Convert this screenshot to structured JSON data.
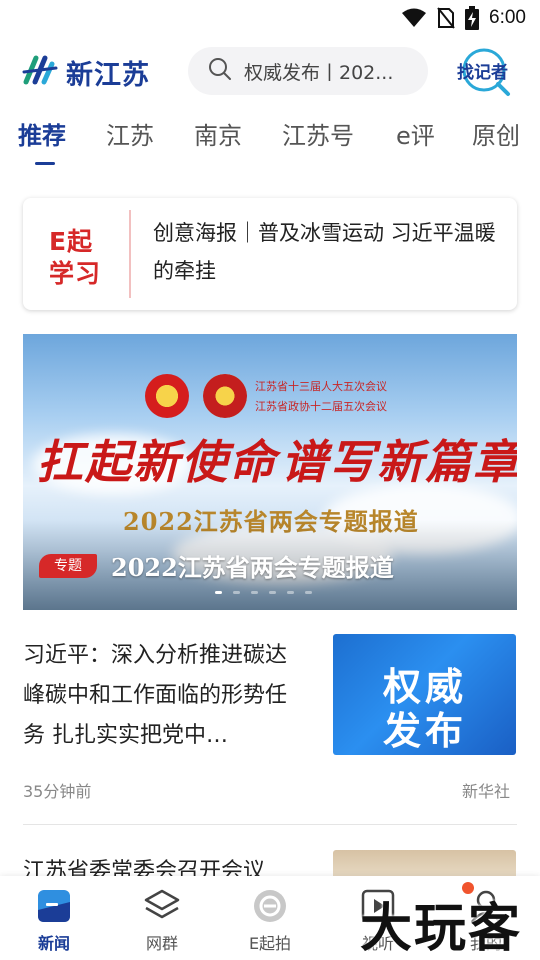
{
  "status_bar": {
    "time": "6:00",
    "icons": [
      "wifi-icon",
      "no-sim-icon",
      "battery-charging-icon"
    ]
  },
  "header": {
    "logo_text": "新江苏",
    "search_placeholder": "权威发布丨202...",
    "reporter_label": "找记者"
  },
  "tabs": [
    {
      "label": "推荐",
      "active": true
    },
    {
      "label": "江苏"
    },
    {
      "label": "南京"
    },
    {
      "label": "江苏号"
    },
    {
      "label": "e评"
    },
    {
      "label": "原创"
    }
  ],
  "study_card": {
    "logo_line1": "E起",
    "logo_line2": "学习",
    "text": "创意海报｜普及冰雪运动  习近平温暖的牵挂"
  },
  "banner": {
    "meeting1": "江苏省十三届人大五次会议",
    "meeting2": "江苏省政协十二届五次会议",
    "slogan1": "扛起新使命",
    "slogan2": "谱写新篇章",
    "subtitle": "2022江苏省两会专题报道",
    "badge": "专题",
    "title": "2022江苏省两会专题报道",
    "slide_count": 6,
    "active_slide": 0
  },
  "news": [
    {
      "title": "习近平：深入分析推进碳达峰碳中和工作面临的形势任务  扎扎实实把党中…",
      "thumb_line1": "权威",
      "thumb_line2": "发布",
      "time": "35分钟前",
      "source": "新华社"
    },
    {
      "title": "江苏省委常委会召开会议"
    }
  ],
  "bottom_nav": [
    {
      "label": "新闻",
      "icon": "news-icon",
      "active": true
    },
    {
      "label": "网群",
      "icon": "layers-icon"
    },
    {
      "label": "E起拍",
      "icon": "e-shoot-icon"
    },
    {
      "label": "视听",
      "icon": "video-icon"
    },
    {
      "label": "我的",
      "icon": "profile-icon",
      "badge_dot": true
    }
  ],
  "watermark": "大玩客",
  "colors": {
    "brand_blue": "#1b3d97",
    "accent_red": "#d62828",
    "notify_orange": "#f0542d"
  }
}
